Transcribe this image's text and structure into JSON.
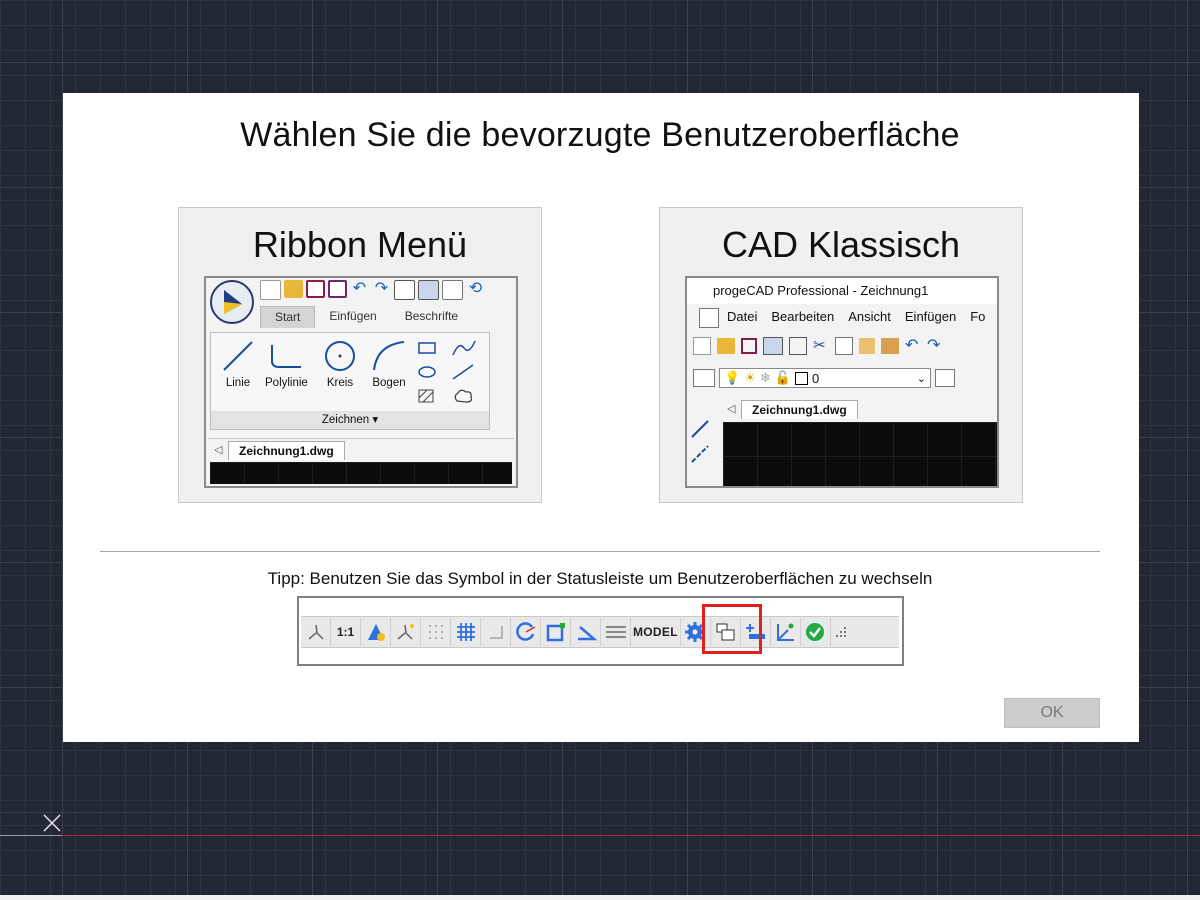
{
  "dialog": {
    "title": "Wählen Sie die bevorzugte Benutzeroberfläche",
    "tip": "Tipp: Benutzen Sie das Symbol in der Statusleiste um Benutzeroberflächen zu wechseln",
    "ok_label": "OK",
    "ok_enabled": false
  },
  "options": {
    "ribbon": {
      "title": "Ribbon Menü",
      "tabs": [
        "Start",
        "Einfügen",
        "Beschrifte"
      ],
      "tools": [
        "Linie",
        "Polylinie",
        "Kreis",
        "Bogen"
      ],
      "panel_label": "Zeichnen",
      "doc_tab": "Zeichnung1.dwg"
    },
    "classic": {
      "title": "CAD Klassisch",
      "window_title": "progeCAD Professional - Zeichnung1",
      "menu": [
        "Datei",
        "Bearbeiten",
        "Ansicht",
        "Einfügen",
        "Fo"
      ],
      "layer_value": "0",
      "doc_tab": "Zeichnung1.dwg"
    }
  },
  "statusbar": {
    "scale_label": "1:1",
    "model_label": "MODEL",
    "highlighted_item": "gear-icon",
    "highlight_color": "#e02020"
  },
  "colors": {
    "canvas_bg": "#222833",
    "accent_blue": "#2f6fe0",
    "x_axis": "#b0262c"
  }
}
